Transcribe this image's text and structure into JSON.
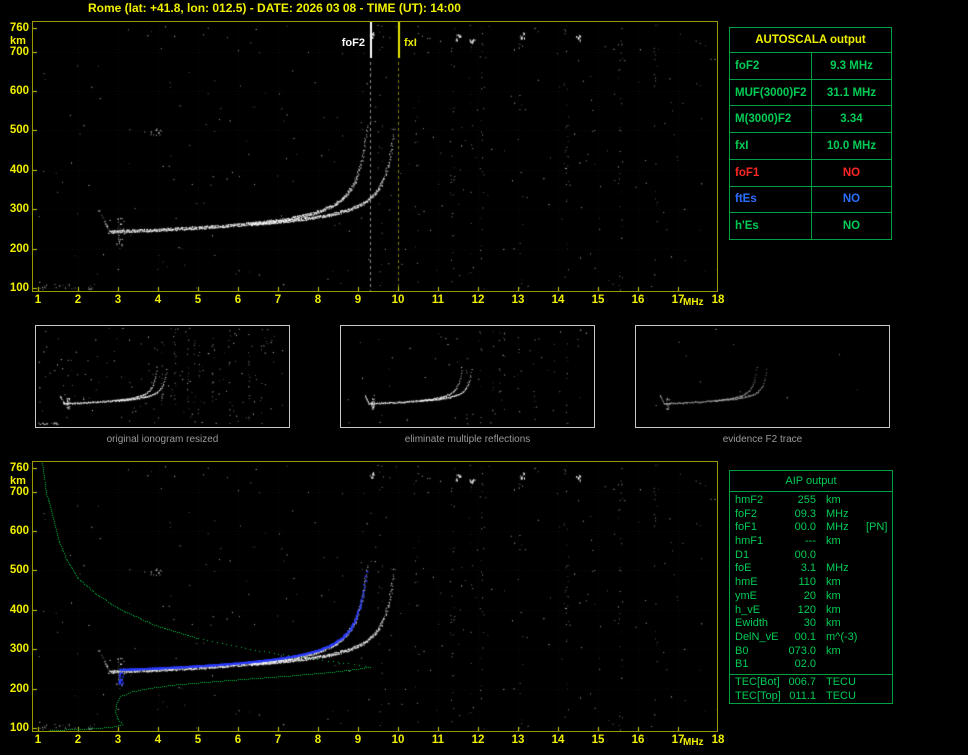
{
  "title": "Rome (lat: +41.8, lon: 012.5) - DATE: 2026 03 08 - TIME (UT): 14:00",
  "colors": {
    "axis_yellow": "#f0f000",
    "plot_border": "#9a9a00",
    "table_border": "#00a040",
    "green_text": "#00cc55",
    "red_text": "#ff2626",
    "blue_text": "#2b6fff",
    "caption_gray": "#9a9a9a",
    "trace_white": "#ffffff",
    "profile_green": "#00c040",
    "model_blue": "#2a3cff",
    "fxi_line_yellow": "#e8e800"
  },
  "ionogram": {
    "x_ticks": [
      "1",
      "2",
      "3",
      "4",
      "5",
      "6",
      "7",
      "8",
      "9",
      "10",
      "11",
      "12",
      "13",
      "14",
      "15",
      "16",
      "17",
      "18"
    ],
    "x_unit": "MHz",
    "y_ticks": [
      "760",
      "700",
      "600",
      "500",
      "400",
      "300",
      "200",
      "100"
    ],
    "y_unit": "km",
    "fof2_label": "foF2",
    "fxi_label": "fxI"
  },
  "autoscala_table": {
    "title": "AUTOSCALA output",
    "rows": [
      {
        "label": "foF2",
        "value": "9.3 MHz",
        "color": "green"
      },
      {
        "label": "MUF(3000)F2",
        "value": "31.1 MHz",
        "color": "green"
      },
      {
        "label": "M(3000)F2",
        "value": "3.34",
        "color": "green"
      },
      {
        "label": "fxI",
        "value": "10.0 MHz",
        "color": "green"
      },
      {
        "label": "foF1",
        "value": "NO",
        "color": "red"
      },
      {
        "label": "ftEs",
        "value": "NO",
        "color": "blue"
      },
      {
        "label": "h'Es",
        "value": "NO",
        "color": "green"
      }
    ]
  },
  "thumbnails": [
    {
      "caption": "original ionogram resized"
    },
    {
      "caption": "eliminate multiple reflections"
    },
    {
      "caption": "evidence F2 trace"
    }
  ],
  "aip_table": {
    "title": "AIP output",
    "rows": [
      {
        "label": "hmF2",
        "value": "255",
        "unit": "km",
        "extra": ""
      },
      {
        "label": "foF2",
        "value": "09.3",
        "unit": "MHz",
        "extra": ""
      },
      {
        "label": "foF1",
        "value": "00.0",
        "unit": "MHz",
        "extra": "[PN]"
      },
      {
        "label": "hmF1",
        "value": "---",
        "unit": "km",
        "extra": ""
      },
      {
        "label": "D1",
        "value": "00.0",
        "unit": "",
        "extra": ""
      },
      {
        "label": "foE",
        "value": "3.1",
        "unit": "MHz",
        "extra": ""
      },
      {
        "label": "hmE",
        "value": "110",
        "unit": "km",
        "extra": ""
      },
      {
        "label": "ymE",
        "value": "20",
        "unit": "km",
        "extra": ""
      },
      {
        "label": "h_vE",
        "value": "120",
        "unit": "km",
        "extra": ""
      },
      {
        "label": "Ewidth",
        "value": "30",
        "unit": "km",
        "extra": ""
      },
      {
        "label": "DelN_vE",
        "value": "00.1",
        "unit": "m^(-3)",
        "extra": ""
      },
      {
        "label": "B0",
        "value": "073.0",
        "unit": "km",
        "extra": ""
      },
      {
        "label": "B1",
        "value": "02.0",
        "unit": "",
        "extra": ""
      }
    ],
    "tec_rows": [
      {
        "label": "TEC[Bot]",
        "value": "006.7",
        "unit": "TECU"
      },
      {
        "label": "TEC[Top]",
        "value": "011.1",
        "unit": "TECU"
      }
    ]
  },
  "chart_data": {
    "type": "scatter",
    "description": "Vertical-incidence ionogram (virtual height km vs frequency MHz) with AUTOSCALA scaled parameters, processing thumbnails and AIP electron-density profile",
    "x_axis": {
      "label": "MHz",
      "range": [
        1,
        18
      ],
      "ticks": [
        1,
        2,
        3,
        4,
        5,
        6,
        7,
        8,
        9,
        10,
        11,
        12,
        13,
        14,
        15,
        16,
        17,
        18
      ]
    },
    "y_axis": {
      "label": "km",
      "range": [
        93,
        775
      ],
      "ticks": [
        760,
        700,
        600,
        500,
        400,
        300,
        200,
        100
      ]
    },
    "scaled_values": {
      "foF2_MHz": 9.3,
      "MUF3000F2_MHz": 31.1,
      "M3000F2": 3.34,
      "fxI_MHz": 10.0,
      "foF1": null,
      "ftEs": null,
      "hEs": null
    },
    "profile_parameters": {
      "hmF2_km": 255,
      "foF2_MHz": 9.3,
      "foF1_MHz": 0,
      "foE_MHz": 3.1,
      "hmE_km": 110,
      "ymE_km": 20,
      "h_vE_km": 120,
      "Ewidth_km": 30,
      "DelN_vE": 0.1,
      "B0_km": 73,
      "B1": 2.0,
      "TEC_bot_TECU": 6.7,
      "TEC_top_TECU": 11.1
    },
    "o_trace": {
      "f_start": 2.78,
      "f_end": 9.28,
      "h_base_km": 232,
      "h_quad_km": 28,
      "retard_km": 60,
      "retard_off_mhz": 0.15,
      "critical_mhz": 9.3,
      "h_cap_km": 512
    },
    "x_trace": {
      "f_start": 6.3,
      "f_end": 9.97,
      "h_base_km": 237,
      "h_quad_km": 28,
      "retard_km": 55,
      "retard_off_mhz": 0.12,
      "critical_mhz": 10.0,
      "h_cap_km": 512
    },
    "leading_tail": {
      "f_start": 2.5,
      "f_end": 2.78,
      "h_top_km": 300,
      "h_join_km": 245
    },
    "cusp": {
      "f_mhz": 3.05,
      "h_min_km": 205,
      "h_max_km": 282
    },
    "second_hop": {
      "f_mhz": 3.95,
      "h_km": 495
    },
    "e_region_scatter": {
      "f_min": 1.0,
      "f_max": 2.4,
      "h_km": 104
    },
    "noise_streaks_mhz": [
      9.55,
      10.45,
      11.35,
      11.8,
      12.1,
      13.05,
      14.2,
      15.55,
      16.45
    ],
    "top_blobs": [
      [
        11.5,
        738
      ],
      [
        11.85,
        730
      ],
      [
        13.1,
        742
      ],
      [
        14.5,
        735
      ],
      [
        9.35,
        745
      ]
    ],
    "profile_topside": [
      [
        1.1,
        772
      ],
      [
        1.2,
        700
      ],
      [
        1.35,
        640
      ],
      [
        1.5,
        580
      ],
      [
        1.7,
        530
      ],
      [
        2.0,
        480
      ],
      [
        2.45,
        440
      ],
      [
        3.05,
        402
      ],
      [
        3.9,
        362
      ],
      [
        5.0,
        328
      ],
      [
        6.3,
        300
      ],
      [
        7.6,
        280
      ],
      [
        8.75,
        264
      ],
      [
        9.3,
        255
      ]
    ],
    "profile_dotted_from_mhz": 5.2,
    "profile_bottomside": [
      [
        9.3,
        255
      ],
      [
        8.5,
        244
      ],
      [
        7.4,
        234
      ],
      [
        6.2,
        225
      ],
      [
        5.2,
        217
      ],
      [
        4.4,
        210
      ],
      [
        3.8,
        202
      ],
      [
        3.35,
        193
      ],
      [
        3.05,
        181
      ],
      [
        2.95,
        162
      ],
      [
        2.93,
        140
      ],
      [
        3.0,
        122
      ],
      [
        3.1,
        110
      ],
      [
        2.9,
        104
      ],
      [
        2.5,
        100
      ],
      [
        1.9,
        97
      ],
      [
        1.3,
        95
      ]
    ],
    "blue_trace": {
      "f_start": 3.02,
      "f_end": 9.27,
      "h_offset_km": 3,
      "h_cap_km": 505,
      "start_cluster": {
        "f": 3.06,
        "h_min": 210,
        "h_max": 242
      }
    }
  }
}
